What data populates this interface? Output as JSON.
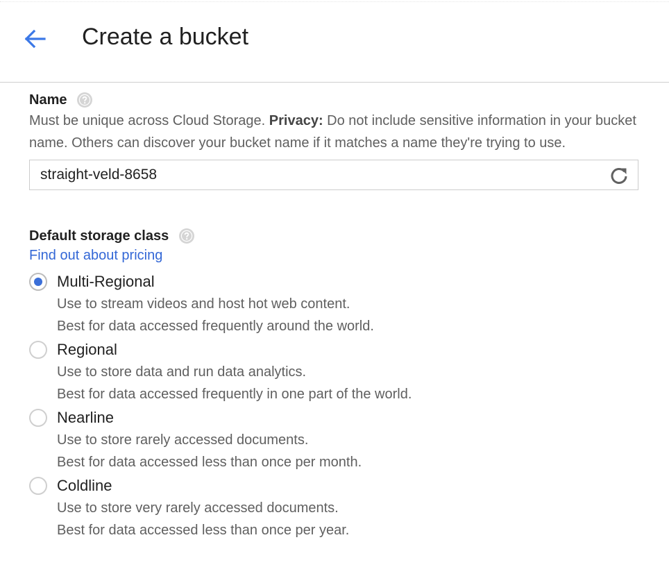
{
  "header": {
    "title": "Create a bucket"
  },
  "name_section": {
    "label": "Name",
    "description_prefix": "Must be unique across Cloud Storage. ",
    "description_bold": "Privacy:",
    "description_suffix": " Do not include sensitive information in your bucket name. Others can discover your bucket name if it matches a name they're trying to use.",
    "input_value": "straight-veld-8658"
  },
  "storage_section": {
    "label": "Default storage class",
    "pricing_link": "Find out about pricing",
    "options": [
      {
        "label": "Multi-Regional",
        "desc_line1": "Use to stream videos and host hot web content.",
        "desc_line2": "Best for data accessed frequently around the world.",
        "selected": true
      },
      {
        "label": "Regional",
        "desc_line1": "Use to store data and run data analytics.",
        "desc_line2": "Best for data accessed frequently in one part of the world.",
        "selected": false
      },
      {
        "label": "Nearline",
        "desc_line1": "Use to store rarely accessed documents.",
        "desc_line2": "Best for data accessed less than once per month.",
        "selected": false
      },
      {
        "label": "Coldline",
        "desc_line1": "Use to store very rarely accessed documents.",
        "desc_line2": "Best for data accessed less than once per year.",
        "selected": false
      }
    ]
  },
  "colors": {
    "accent": "#3367d6",
    "radio_selected": "#3b6fd8",
    "back_arrow": "#3b78e7",
    "help_icon": "#cfcfcf",
    "refresh_icon": "#616161"
  },
  "icons": {
    "back": "arrow-left-icon",
    "help": "help-circle-icon",
    "refresh": "refresh-icon"
  }
}
